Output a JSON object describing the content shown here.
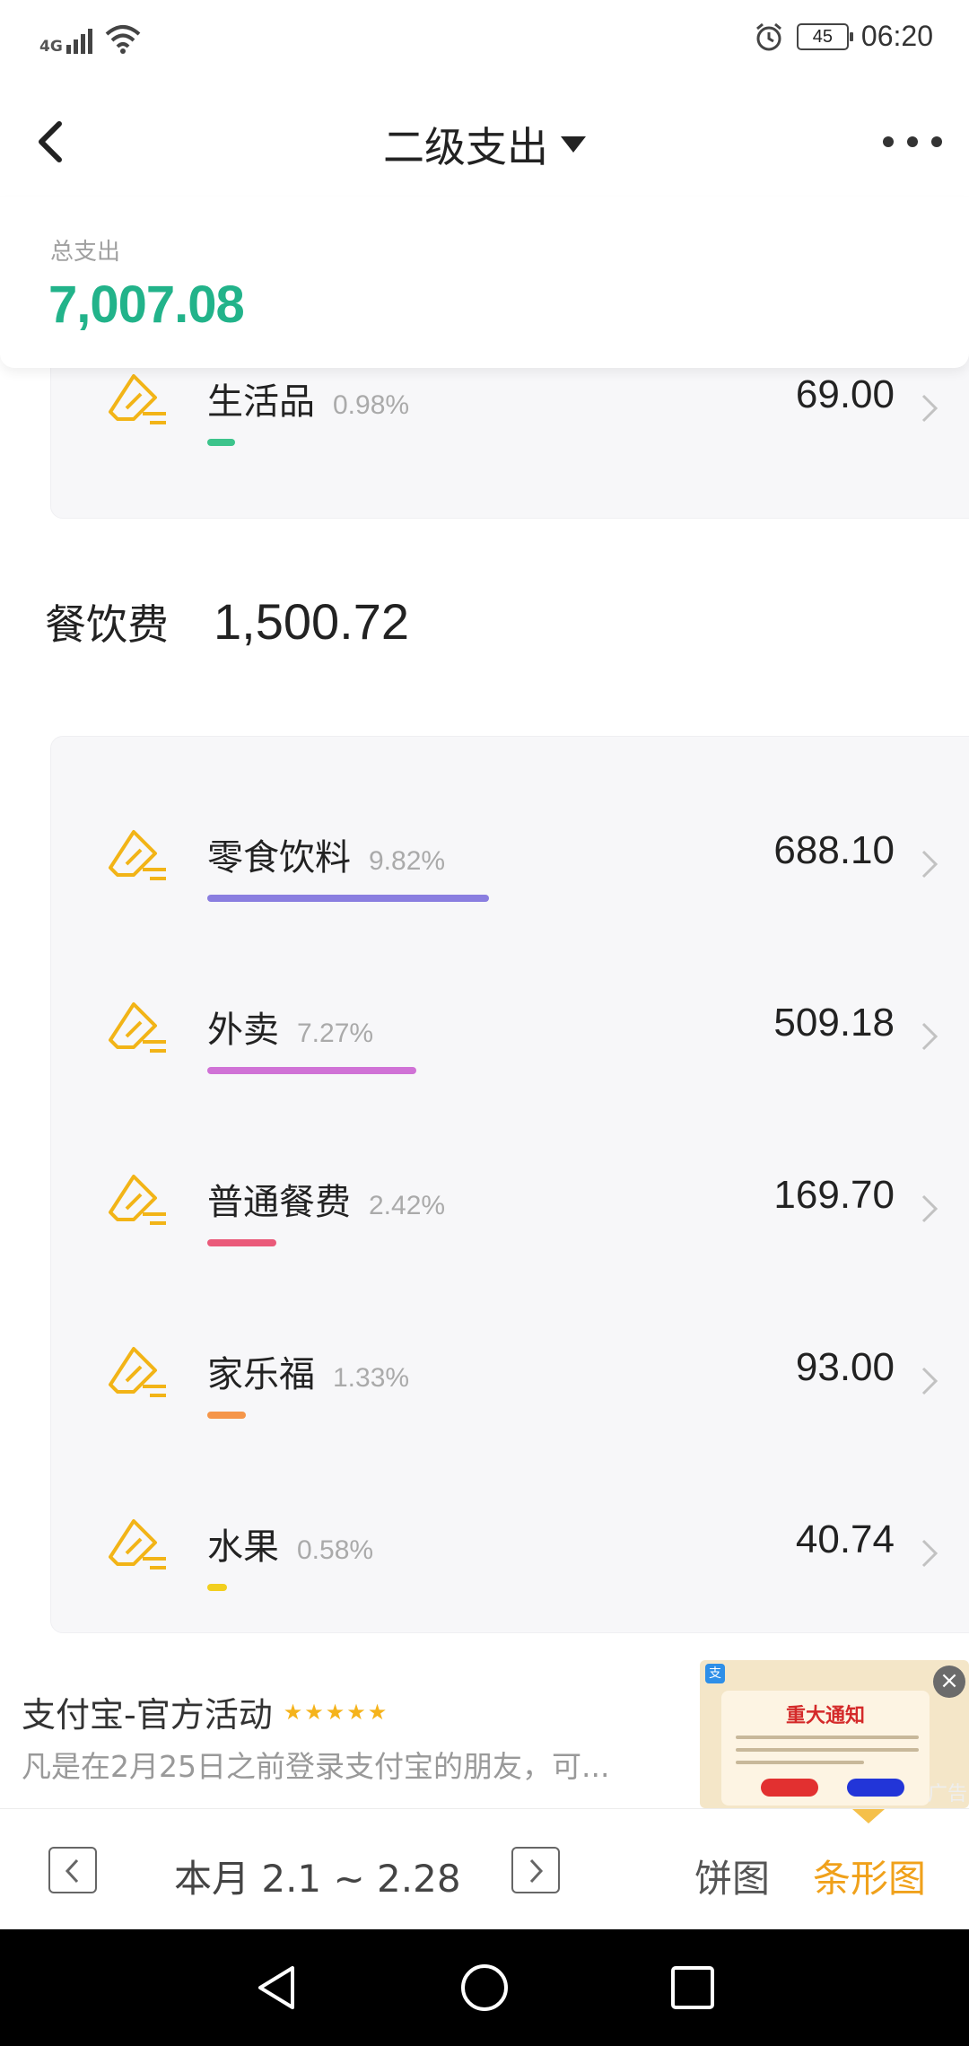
{
  "status_bar": {
    "network": "4G",
    "time": "06:20",
    "battery": "45"
  },
  "header": {
    "title": "二级支出"
  },
  "summary": {
    "label": "总支出",
    "value": "7,007.08"
  },
  "top_partial_item": {
    "name": "生活品",
    "percent": "0.98%",
    "amount": "69.00",
    "bar_fraction": 0.0098,
    "bar_color": "#3dc48c"
  },
  "section": {
    "name": "餐饮费",
    "total": "1,500.72",
    "items": [
      {
        "name": "零食饮料",
        "percent": "9.82%",
        "amount": "688.10",
        "bar_fraction": 0.0982,
        "bar_color": "#8a7ee0"
      },
      {
        "name": "外卖",
        "percent": "7.27%",
        "amount": "509.18",
        "bar_fraction": 0.0727,
        "bar_color": "#d072d6"
      },
      {
        "name": "普通餐费",
        "percent": "2.42%",
        "amount": "169.70",
        "bar_fraction": 0.0242,
        "bar_color": "#ea5a7a"
      },
      {
        "name": "家乐福",
        "percent": "1.33%",
        "amount": "93.00",
        "bar_fraction": 0.0133,
        "bar_color": "#f5964a"
      },
      {
        "name": "水果",
        "percent": "0.58%",
        "amount": "40.74",
        "bar_fraction": 0.0058,
        "bar_color": "#f2cf1f"
      }
    ]
  },
  "ad": {
    "title": "支付宝-官方活动",
    "stars": "★★★★★",
    "description": "凡是在2月25日之前登录支付宝的朋友，可...",
    "image_title": "重大通知",
    "label": "广告",
    "close": "×"
  },
  "bottom_bar": {
    "period": "本月 2.1 ~ 2.28",
    "tab_pie": "饼图",
    "tab_bar": "条形图"
  },
  "colors": {
    "accent_green": "#22b38a",
    "accent_orange": "#f0a11b",
    "icon_yellow": "#f2b417"
  }
}
